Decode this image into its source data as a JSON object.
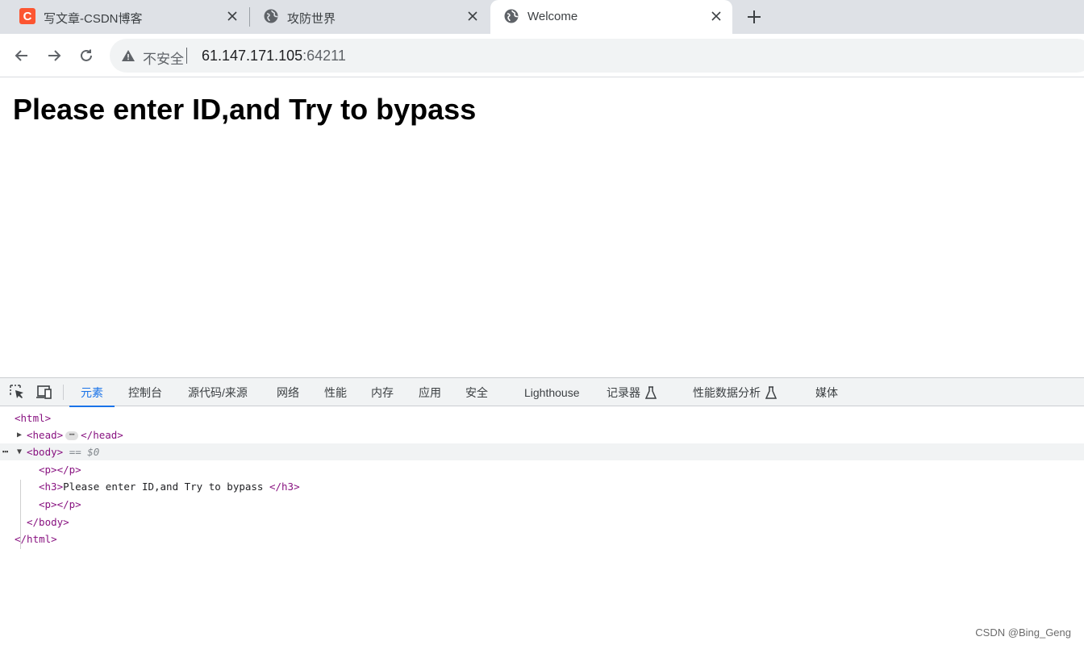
{
  "browser": {
    "tabs": [
      {
        "title": "写文章-CSDN博客",
        "favicon": "csdn-logo",
        "favicon_letter": "C",
        "active": false
      },
      {
        "title": "攻防世界",
        "favicon": "globe-icon",
        "active": false
      },
      {
        "title": "Welcome",
        "favicon": "globe-icon",
        "active": true
      }
    ],
    "new_tab_icon": "plus-icon",
    "address_bar": {
      "security_label": "不安全",
      "host": "61.147.171.105",
      "port": ":64211"
    }
  },
  "page": {
    "heading": "Please enter ID,and Try to bypass"
  },
  "devtools": {
    "tabs": [
      {
        "label": "元素",
        "active": true
      },
      {
        "label": "控制台"
      },
      {
        "label": "源代码/来源"
      },
      {
        "label": "网络"
      },
      {
        "label": "性能"
      },
      {
        "label": "内存"
      },
      {
        "label": "应用"
      },
      {
        "label": "安全"
      },
      {
        "label": "Lighthouse"
      },
      {
        "label": "记录器",
        "icon": "flask-icon"
      },
      {
        "label": "性能数据分析",
        "icon": "flask-icon"
      },
      {
        "label": "媒体"
      }
    ],
    "dom": {
      "html_open": "<html>",
      "head_open": "<head>",
      "head_close": "</head>",
      "head_ellipsis": "⋯",
      "body_open": "<body>",
      "body_marker": "== $0",
      "p1": "<p></p>",
      "h3_open": "<h3>",
      "h3_text": "Please enter ID,and Try to bypass ",
      "h3_close": "</h3>",
      "p2": "<p></p>",
      "body_close": "</body>",
      "html_close": "</html>",
      "gutter_dots": "⋯"
    }
  },
  "watermark": "CSDN @Bing_Geng",
  "colors": {
    "tabstrip": "#dee1e6",
    "accent": "#1a73e8",
    "tag": "#881280",
    "csdn": "#fc5531"
  }
}
